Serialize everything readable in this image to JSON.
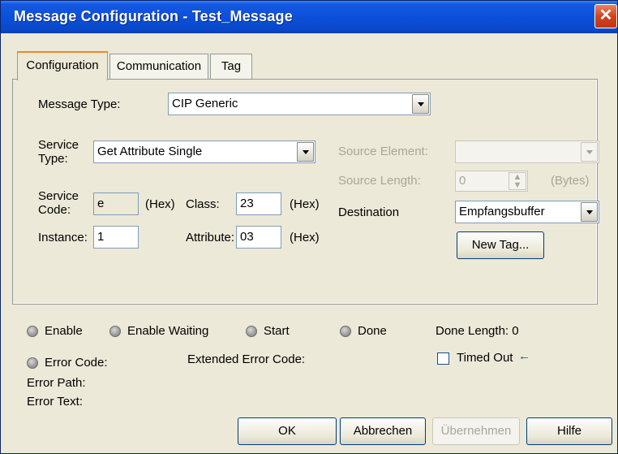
{
  "window": {
    "title": "Message Configuration - Test_Message",
    "close_label": "✕"
  },
  "tabs": [
    {
      "label": "Configuration"
    },
    {
      "label": "Communication"
    },
    {
      "label": "Tag"
    }
  ],
  "config": {
    "message_type_label": "Message Type:",
    "message_type_value": "CIP Generic",
    "service_type_label_1": "Service",
    "service_type_label_2": "Type:",
    "service_type_value": "Get Attribute Single",
    "service_code_label_1": "Service",
    "service_code_label_2": "Code:",
    "service_code_value": "e",
    "hex1": "(Hex)",
    "class_label": "Class:",
    "class_value": "23",
    "hex2": "(Hex)",
    "instance_label": "Instance:",
    "instance_value": "1",
    "attribute_label": "Attribute:",
    "attribute_value": "03",
    "hex3": "(Hex)",
    "source_element_label": "Source Element:",
    "source_length_label": "Source Length:",
    "source_length_value": "0",
    "bytes_label": "(Bytes)",
    "destination_label": "Destination",
    "destination_value": "Empfangsbuffer",
    "new_tag_label": "New Tag..."
  },
  "status": {
    "enable": "Enable",
    "enable_waiting": "Enable Waiting",
    "start": "Start",
    "done": "Done",
    "done_length": "Done Length: 0",
    "error_code": "Error Code:",
    "extended_error_code": "Extended Error Code:",
    "timed_out": "Timed Out",
    "error_path": "Error Path:",
    "error_text": "Error Text:"
  },
  "buttons": {
    "ok": "OK",
    "cancel": "Abbrechen",
    "apply": "Übernehmen",
    "help": "Hilfe"
  },
  "colors": {
    "titlebar": "#0a47c8",
    "dialog_bg": "#ece9d8",
    "close_button": "#d1441b"
  }
}
